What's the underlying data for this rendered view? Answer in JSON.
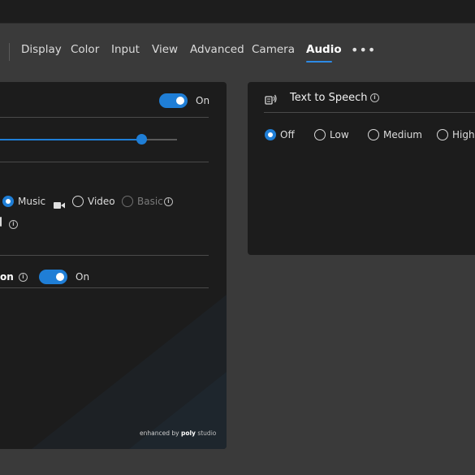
{
  "nav": {
    "tabs": [
      {
        "label": "Display"
      },
      {
        "label": "Color"
      },
      {
        "label": "Input"
      },
      {
        "label": "View"
      },
      {
        "label": "Advanced"
      },
      {
        "label": "Camera"
      },
      {
        "label": "Audio",
        "active": true
      }
    ],
    "more_label": "•••"
  },
  "left_panel": {
    "toggle_state_label": "On",
    "slider_value_fraction": 0.8,
    "modes": {
      "music_label": "Music",
      "video_label": "Video",
      "basic_label": "Basic",
      "selected": "Music"
    },
    "partial_row_label": "on",
    "partial_row_state_label": "On"
  },
  "right_panel": {
    "title": "Text to Speech",
    "options": [
      "Off",
      "Low",
      "Medium",
      "High"
    ],
    "selected": "Off"
  },
  "branding": {
    "prefix": "enhanced by",
    "brand": "poly",
    "suffix": "studio"
  },
  "colors": {
    "accent": "#1f7ed6",
    "panel_bg": "#1c1c1c",
    "page_bg": "#3a3a3a"
  }
}
